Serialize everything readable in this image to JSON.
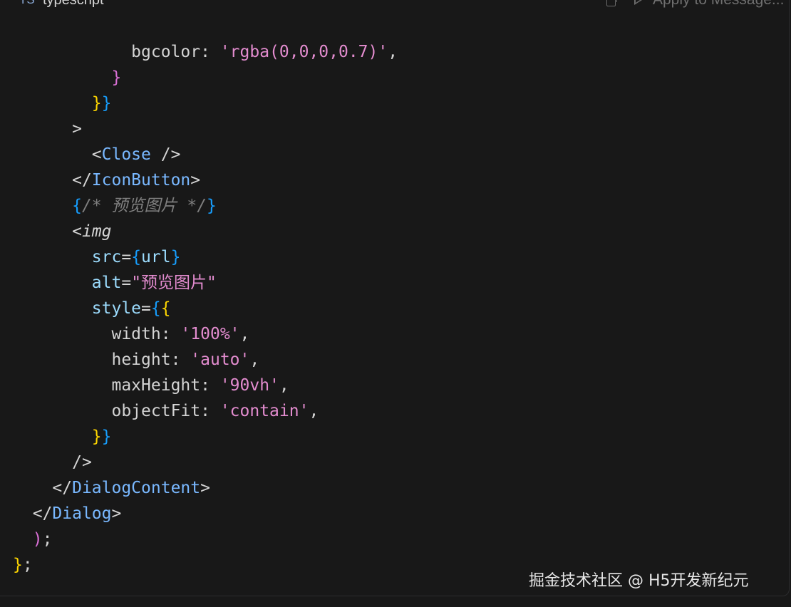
{
  "header": {
    "language_icon": "TS",
    "language_label": "typescript",
    "copy_icon": "copy-icon",
    "apply_label": "Apply to Message..."
  },
  "code": {
    "lines": [
      [
        {
          "t": "            ",
          "c": "tk-punc"
        },
        {
          "t": "bgcolor",
          "c": "tk-key"
        },
        {
          "t": ": ",
          "c": "tk-punc"
        },
        {
          "t": "'rgba(0,0,0,0.7)'",
          "c": "tk-str"
        },
        {
          "t": ",",
          "c": "tk-punc"
        }
      ],
      [
        {
          "t": "          ",
          "c": "tk-punc"
        },
        {
          "t": "}",
          "c": "tk-b2"
        }
      ],
      [
        {
          "t": "        ",
          "c": "tk-punc"
        },
        {
          "t": "}",
          "c": "tk-b1"
        },
        {
          "t": "}",
          "c": "tk-b3"
        }
      ],
      [
        {
          "t": "      ",
          "c": "tk-punc"
        },
        {
          "t": ">",
          "c": "tk-punc"
        }
      ],
      [
        {
          "t": "        ",
          "c": "tk-punc"
        },
        {
          "t": "<",
          "c": "tk-punc"
        },
        {
          "t": "Close",
          "c": "tk-tag"
        },
        {
          "t": " />",
          "c": "tk-punc"
        }
      ],
      [
        {
          "t": "      ",
          "c": "tk-punc"
        },
        {
          "t": "</",
          "c": "tk-punc"
        },
        {
          "t": "IconButton",
          "c": "tk-tag"
        },
        {
          "t": ">",
          "c": "tk-punc"
        }
      ],
      [
        {
          "t": "      ",
          "c": "tk-punc"
        },
        {
          "t": "{",
          "c": "tk-b3"
        },
        {
          "t": "/* 预览图片 */",
          "c": "tk-comment"
        },
        {
          "t": "}",
          "c": "tk-b3"
        }
      ],
      [
        {
          "t": "      ",
          "c": "tk-punc"
        },
        {
          "t": "<",
          "c": "tk-punc"
        },
        {
          "t": "img",
          "c": "tk-tagit"
        }
      ],
      [
        {
          "t": "        ",
          "c": "tk-punc"
        },
        {
          "t": "src",
          "c": "tk-prop"
        },
        {
          "t": "=",
          "c": "tk-punc"
        },
        {
          "t": "{",
          "c": "tk-b3"
        },
        {
          "t": "url",
          "c": "tk-prop"
        },
        {
          "t": "}",
          "c": "tk-b3"
        }
      ],
      [
        {
          "t": "        ",
          "c": "tk-punc"
        },
        {
          "t": "alt",
          "c": "tk-prop"
        },
        {
          "t": "=",
          "c": "tk-punc"
        },
        {
          "t": "\"预览图片\"",
          "c": "tk-str"
        }
      ],
      [
        {
          "t": "        ",
          "c": "tk-punc"
        },
        {
          "t": "style",
          "c": "tk-prop"
        },
        {
          "t": "=",
          "c": "tk-punc"
        },
        {
          "t": "{",
          "c": "tk-b3"
        },
        {
          "t": "{",
          "c": "tk-b1"
        }
      ],
      [
        {
          "t": "          ",
          "c": "tk-punc"
        },
        {
          "t": "width",
          "c": "tk-key"
        },
        {
          "t": ": ",
          "c": "tk-punc"
        },
        {
          "t": "'100%'",
          "c": "tk-str"
        },
        {
          "t": ",",
          "c": "tk-punc"
        }
      ],
      [
        {
          "t": "          ",
          "c": "tk-punc"
        },
        {
          "t": "height",
          "c": "tk-key"
        },
        {
          "t": ": ",
          "c": "tk-punc"
        },
        {
          "t": "'auto'",
          "c": "tk-str"
        },
        {
          "t": ",",
          "c": "tk-punc"
        }
      ],
      [
        {
          "t": "          ",
          "c": "tk-punc"
        },
        {
          "t": "maxHeight",
          "c": "tk-key"
        },
        {
          "t": ": ",
          "c": "tk-punc"
        },
        {
          "t": "'90vh'",
          "c": "tk-str"
        },
        {
          "t": ",",
          "c": "tk-punc"
        }
      ],
      [
        {
          "t": "          ",
          "c": "tk-punc"
        },
        {
          "t": "objectFit",
          "c": "tk-key"
        },
        {
          "t": ": ",
          "c": "tk-punc"
        },
        {
          "t": "'contain'",
          "c": "tk-str"
        },
        {
          "t": ",",
          "c": "tk-punc"
        }
      ],
      [
        {
          "t": "        ",
          "c": "tk-punc"
        },
        {
          "t": "}",
          "c": "tk-b1"
        },
        {
          "t": "}",
          "c": "tk-b3"
        }
      ],
      [
        {
          "t": "      ",
          "c": "tk-punc"
        },
        {
          "t": "/>",
          "c": "tk-punc"
        }
      ],
      [
        {
          "t": "    ",
          "c": "tk-punc"
        },
        {
          "t": "</",
          "c": "tk-punc"
        },
        {
          "t": "DialogContent",
          "c": "tk-tag"
        },
        {
          "t": ">",
          "c": "tk-punc"
        }
      ],
      [
        {
          "t": "  ",
          "c": "tk-punc"
        },
        {
          "t": "</",
          "c": "tk-punc"
        },
        {
          "t": "Dialog",
          "c": "tk-tag"
        },
        {
          "t": ">",
          "c": "tk-punc"
        }
      ],
      [
        {
          "t": "  ",
          "c": "tk-punc"
        },
        {
          "t": ")",
          "c": "tk-b2"
        },
        {
          "t": ";",
          "c": "tk-punc"
        }
      ],
      [
        {
          "t": "}",
          "c": "tk-b1"
        },
        {
          "t": ";",
          "c": "tk-punc"
        }
      ]
    ]
  },
  "watermark": "掘金技术社区 @ H5开发新纪元"
}
